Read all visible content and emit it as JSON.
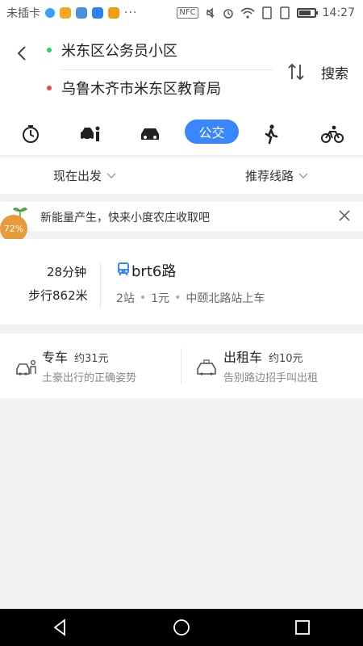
{
  "status_bar": {
    "carrier": "未插卡",
    "time": "14:27",
    "nfc": "NFC",
    "overflow": "···"
  },
  "header": {
    "origin": "米东区公务员小区",
    "destination": "乌鲁木齐市米东区教育局",
    "search_label": "搜索"
  },
  "modes": {
    "active_label": "公交",
    "items": [
      "timer-icon",
      "taxi-icon",
      "car-icon",
      "bus",
      "walk-icon",
      "bike-icon"
    ]
  },
  "filters": {
    "depart": "现在出发",
    "route_pref": "推荐线路"
  },
  "promo": {
    "text": "新能量产生，快来小度农庄收取吧",
    "badge": "72%"
  },
  "route_card": {
    "duration": "28分钟",
    "walk": "步行862米",
    "line": "brt6路",
    "stops": "2站",
    "fare": "1元",
    "board_at": "中颐北路站上车"
  },
  "other_options": {
    "premier": {
      "title": "专车",
      "price": "约31元",
      "subtitle": "土豪出行的正确姿势"
    },
    "taxi": {
      "title": "出租车",
      "price": "约10元",
      "subtitle": "告别路边招手叫出租"
    }
  },
  "colors": {
    "accent": "#3a86ff",
    "origin_dot": "#2ecc71",
    "dest_dot": "#e74c3c"
  }
}
